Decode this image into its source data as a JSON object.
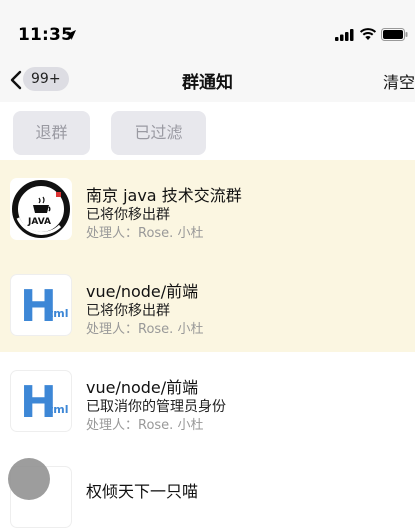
{
  "status": {
    "time": "11:35",
    "location_icon": "location-arrow-icon",
    "signal_icon": "cellular-signal-icon",
    "wifi_icon": "wifi-icon",
    "battery_icon": "battery-icon"
  },
  "nav": {
    "back_icon": "chevron-left-icon",
    "badge": "99+",
    "title": "群通知",
    "clear_label": "清空"
  },
  "filters": {
    "quit_label": "退群",
    "filtered_label": "已过滤"
  },
  "items": [
    {
      "title": "南京 java 技术交流群",
      "desc": "已将你移出群",
      "handler": "处理人：Rose. 小杜",
      "avatar_text": "JAVA",
      "unread": true
    },
    {
      "title": "vue/node/前端",
      "desc": "已将你移出群",
      "handler": "处理人：Rose. 小杜",
      "avatar_text": "Html",
      "unread": true
    },
    {
      "title": "vue/node/前端",
      "desc": "已取消你的管理员身份",
      "handler": "处理人：Rose. 小杜",
      "avatar_text": "Html",
      "unread": false
    },
    {
      "title": "权倾天下一只喵",
      "unread": false
    }
  ],
  "colors": {
    "unread_bg": "#fbf6e1",
    "html_logo": "#3d87d6",
    "button_bg": "#e8e8ed"
  }
}
